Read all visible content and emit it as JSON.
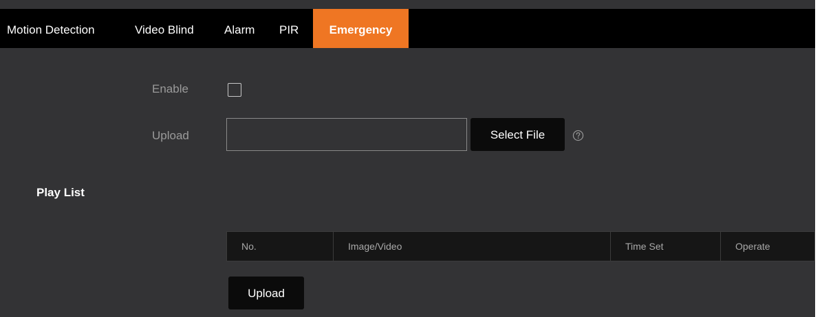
{
  "tabs": [
    {
      "label": "Motion Detection",
      "active": false
    },
    {
      "label": "Video Blind",
      "active": false
    },
    {
      "label": "Alarm",
      "active": false
    },
    {
      "label": "PIR",
      "active": false
    },
    {
      "label": "Emergency",
      "active": true
    }
  ],
  "form": {
    "enable_label": "Enable",
    "enable_checked": false,
    "upload_label": "Upload",
    "upload_value": "",
    "select_file_label": "Select File",
    "help_icon": "question-circle-icon"
  },
  "playlist": {
    "title": "Play List",
    "columns": [
      "No.",
      "Image/Video",
      "Time Set",
      "Operate"
    ],
    "rows": [],
    "upload_label": "Upload"
  },
  "colors": {
    "accent": "#ef7623",
    "tabbar_background": "#000000",
    "panel_background": "#333335",
    "button_background": "#0b0b0b"
  }
}
